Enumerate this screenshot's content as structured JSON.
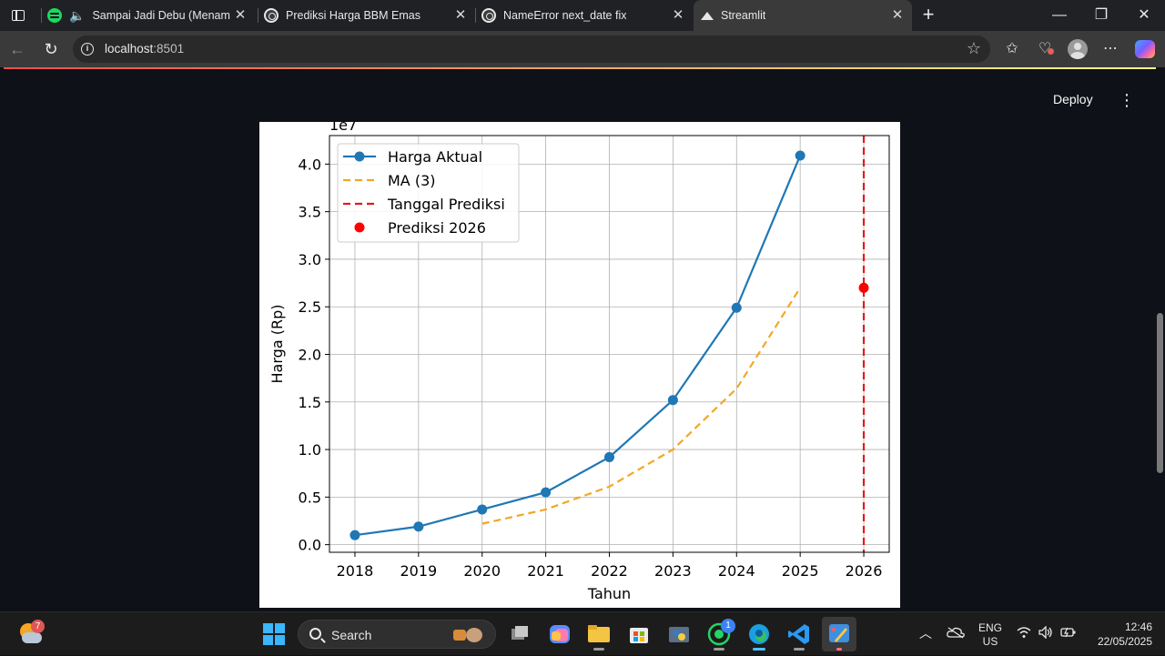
{
  "browser": {
    "tabs": [
      {
        "title": "Sampai Jadi Debu (Menampilkan",
        "favicon": "spotify-icon",
        "audio": true
      },
      {
        "title": "Prediksi Harga BBM Emas",
        "favicon": "chatgpt-icon"
      },
      {
        "title": "NameError next_date fix",
        "favicon": "chatgpt-icon"
      },
      {
        "title": "Streamlit",
        "favicon": "streamlit-icon",
        "active": true
      }
    ],
    "url_host": "localhost",
    "url_port": ":8501"
  },
  "app": {
    "deploy_label": "Deploy"
  },
  "chart_data": {
    "type": "line",
    "xlabel": "Tahun",
    "ylabel": "Harga (Rp)",
    "y_offset_label": "1e7",
    "ylim": [
      -0.08,
      4.3
    ],
    "xlim": [
      2017.6,
      2026.4
    ],
    "y_ticks": [
      "0.0",
      "0.5",
      "1.0",
      "1.5",
      "2.0",
      "2.5",
      "3.0",
      "3.5",
      "4.0"
    ],
    "x_ticks": [
      "2018",
      "2019",
      "2020",
      "2021",
      "2022",
      "2023",
      "2024",
      "2025",
      "2026"
    ],
    "grid": true,
    "legend_position": "top-left",
    "series": [
      {
        "name": "Harga Aktual",
        "style": "line-marker",
        "color": "#1f77b4",
        "x": [
          2018,
          2019,
          2020,
          2021,
          2022,
          2023,
          2024,
          2025
        ],
        "y": [
          0.1,
          0.19,
          0.37,
          0.55,
          0.92,
          1.52,
          2.49,
          4.09
        ]
      },
      {
        "name": "MA (3)",
        "style": "dashed",
        "color": "#f5a623",
        "x": [
          2020,
          2021,
          2022,
          2023,
          2024,
          2025
        ],
        "y": [
          0.22,
          0.37,
          0.61,
          1.0,
          1.64,
          2.7
        ]
      },
      {
        "name": "Tanggal Prediksi",
        "style": "vline-dashed",
        "color": "#e31a1c",
        "x": 2026
      },
      {
        "name": "Prediksi 2026",
        "style": "point",
        "color": "#ff0000",
        "x": 2026,
        "y": 2.7
      }
    ]
  },
  "taskbar": {
    "weather_badge": "7",
    "search_label": "Search",
    "whatsapp_badge": "1",
    "lang_top": "ENG",
    "lang_bottom": "US",
    "time": "12:46",
    "date": "22/05/2025"
  }
}
